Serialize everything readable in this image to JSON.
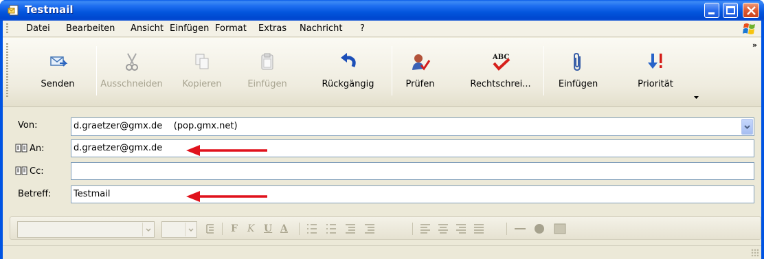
{
  "window": {
    "title": "Testmail"
  },
  "menu": [
    "Datei",
    "Bearbeiten",
    "Ansicht",
    "Einfügen",
    "Format",
    "Extras",
    "Nachricht",
    "?"
  ],
  "toolbar": {
    "send": "Senden",
    "cut": "Ausschneiden",
    "copy": "Kopieren",
    "paste": "Einfügen",
    "undo": "Rückgängig",
    "check": "Prüfen",
    "spelling": "Rechtschrei...",
    "attach": "Einfügen",
    "priority": "Priorität",
    "overflow": "»"
  },
  "fields": {
    "from_label": "Von:",
    "from_value": "d.graetzer@gmx.de    (pop.gmx.net)",
    "to_label": "An:",
    "to_value": "d.graetzer@gmx.de",
    "cc_label": "Cc:",
    "cc_value": "",
    "subject_label": "Betreff:",
    "subject_value": "Testmail"
  },
  "format_bar": {
    "bold": "F",
    "italic": "K",
    "underline": "U",
    "font_color": "A"
  },
  "colors": {
    "titlebar": "#0054e3",
    "annotation_arrow": "#e0121c",
    "chrome": "#ece9d8"
  }
}
